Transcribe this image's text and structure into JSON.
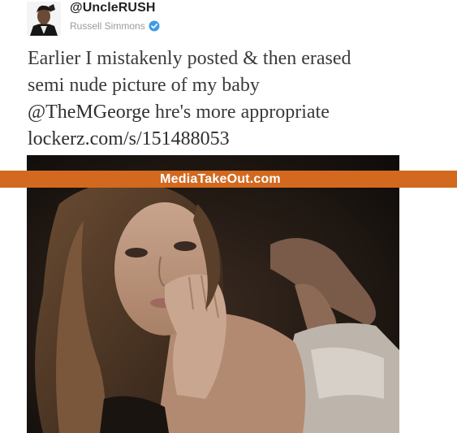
{
  "tweet": {
    "handle": "@UncleRUSH",
    "display_name": "Russell Simmons",
    "line1": "Earlier I mistakenly posted & then erased",
    "line2": "semi nude picture of my baby",
    "line3_mention": "@TheMGeorge",
    "line3_rest": " hre's more appropriate",
    "line4_link": "lockerz.com/s/151488053"
  },
  "watermark": {
    "text": "MediaTakeOut.com"
  },
  "colors": {
    "banner": "#d2691e",
    "verified": "#3b9ce8",
    "text": "#3a3a3a"
  },
  "icons": {
    "verified": "verified-badge-icon"
  }
}
